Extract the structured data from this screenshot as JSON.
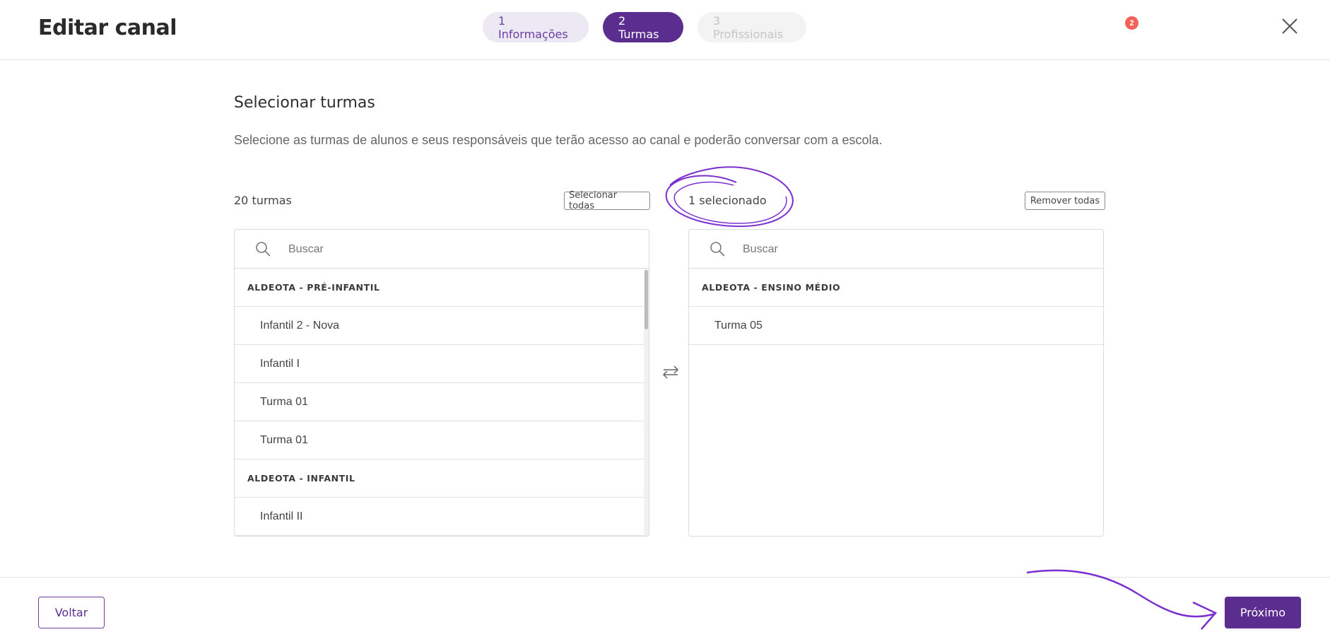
{
  "header": {
    "title": "Editar canal",
    "steps": [
      {
        "label": "1 Informações",
        "state": "done"
      },
      {
        "label": "2 Turmas",
        "state": "active"
      },
      {
        "label": "3 Profissionais",
        "state": "future"
      }
    ],
    "notification_count": "2",
    "close_icon": "close-icon"
  },
  "section": {
    "title": "Selecionar turmas",
    "description": "Selecione as turmas de alunos e seus responsáveis que terão acesso ao canal e poderão conversar com a escola."
  },
  "left_panel": {
    "count": "20 turmas",
    "select_all_label": "Selecionar todas",
    "search_placeholder": "Buscar",
    "rows": [
      {
        "type": "group",
        "label": "ALDEOTA - PRÉ-INFANTIL"
      },
      {
        "type": "item",
        "label": "Infantil 2 - Nova"
      },
      {
        "type": "item",
        "label": "Infantil I"
      },
      {
        "type": "item",
        "label": "Turma 01"
      },
      {
        "type": "item",
        "label": "Turma 01"
      },
      {
        "type": "group",
        "label": "ALDEOTA - INFANTIL"
      },
      {
        "type": "item",
        "label": "Infantil II"
      }
    ]
  },
  "right_panel": {
    "count": "1 selecionado",
    "remove_all_label": "Remover todas",
    "search_placeholder": "Buscar",
    "rows": [
      {
        "type": "group",
        "label": "ALDEOTA - ENSINO MÉDIO"
      },
      {
        "type": "item",
        "label": "Turma 05"
      }
    ]
  },
  "footer": {
    "back_label": "Voltar",
    "next_label": "Próximo"
  },
  "colors": {
    "primary": "#5b2d8e",
    "step_done_bg": "#ece8f4",
    "badge": "#f2615a",
    "annotation": "#7b2fd0"
  }
}
